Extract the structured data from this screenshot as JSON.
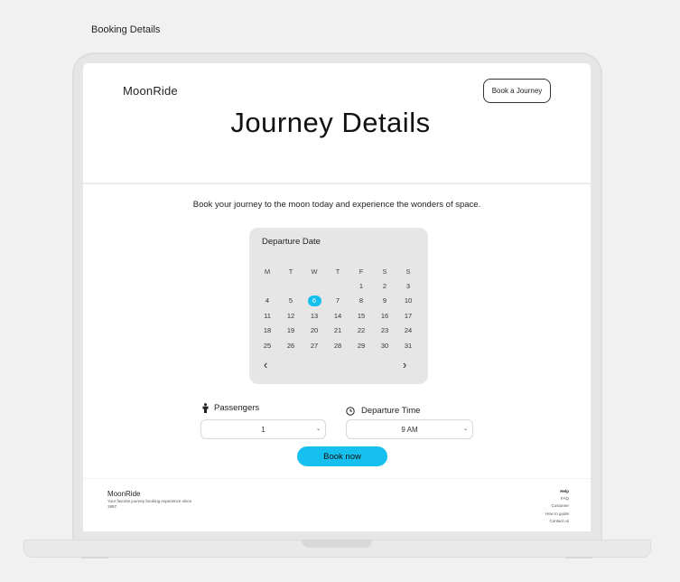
{
  "page_label": "Booking Details",
  "header": {
    "logo": "MoonRide",
    "cta_label": "Book a Journey",
    "title": "Journey Details"
  },
  "tagline": "Book your journey to the moon today and experience the wonders of space.",
  "calendar": {
    "title": "Departure Date",
    "weekdays": [
      "M",
      "T",
      "W",
      "T",
      "F",
      "S",
      "S"
    ],
    "leading_blanks": 4,
    "days": [
      "1",
      "2",
      "3",
      "4",
      "5",
      "6",
      "7",
      "8",
      "9",
      "10",
      "11",
      "12",
      "13",
      "14",
      "15",
      "16",
      "17",
      "18",
      "19",
      "20",
      "21",
      "22",
      "23",
      "24",
      "25",
      "26",
      "27",
      "28",
      "29",
      "30",
      "31"
    ],
    "selected_day": "6",
    "prev_icon": "chevron-left-icon",
    "next_icon": "chevron-right-icon"
  },
  "passengers": {
    "label": "Passengers",
    "icon": "person-icon",
    "value": "1"
  },
  "departure_time": {
    "label": "Departure Time",
    "icon": "clock-icon",
    "value": "9 AM"
  },
  "book_now_label": "Book now",
  "footer": {
    "logo": "MoonRide",
    "description": "Your favorite journey booking experience since 1997.",
    "links_heading": "Help",
    "links": [
      "FAQ",
      "Customer",
      "How to guide",
      "Contact us"
    ]
  },
  "colors": {
    "accent": "#16c0ee",
    "calendar_bg": "#e6e6e6"
  }
}
